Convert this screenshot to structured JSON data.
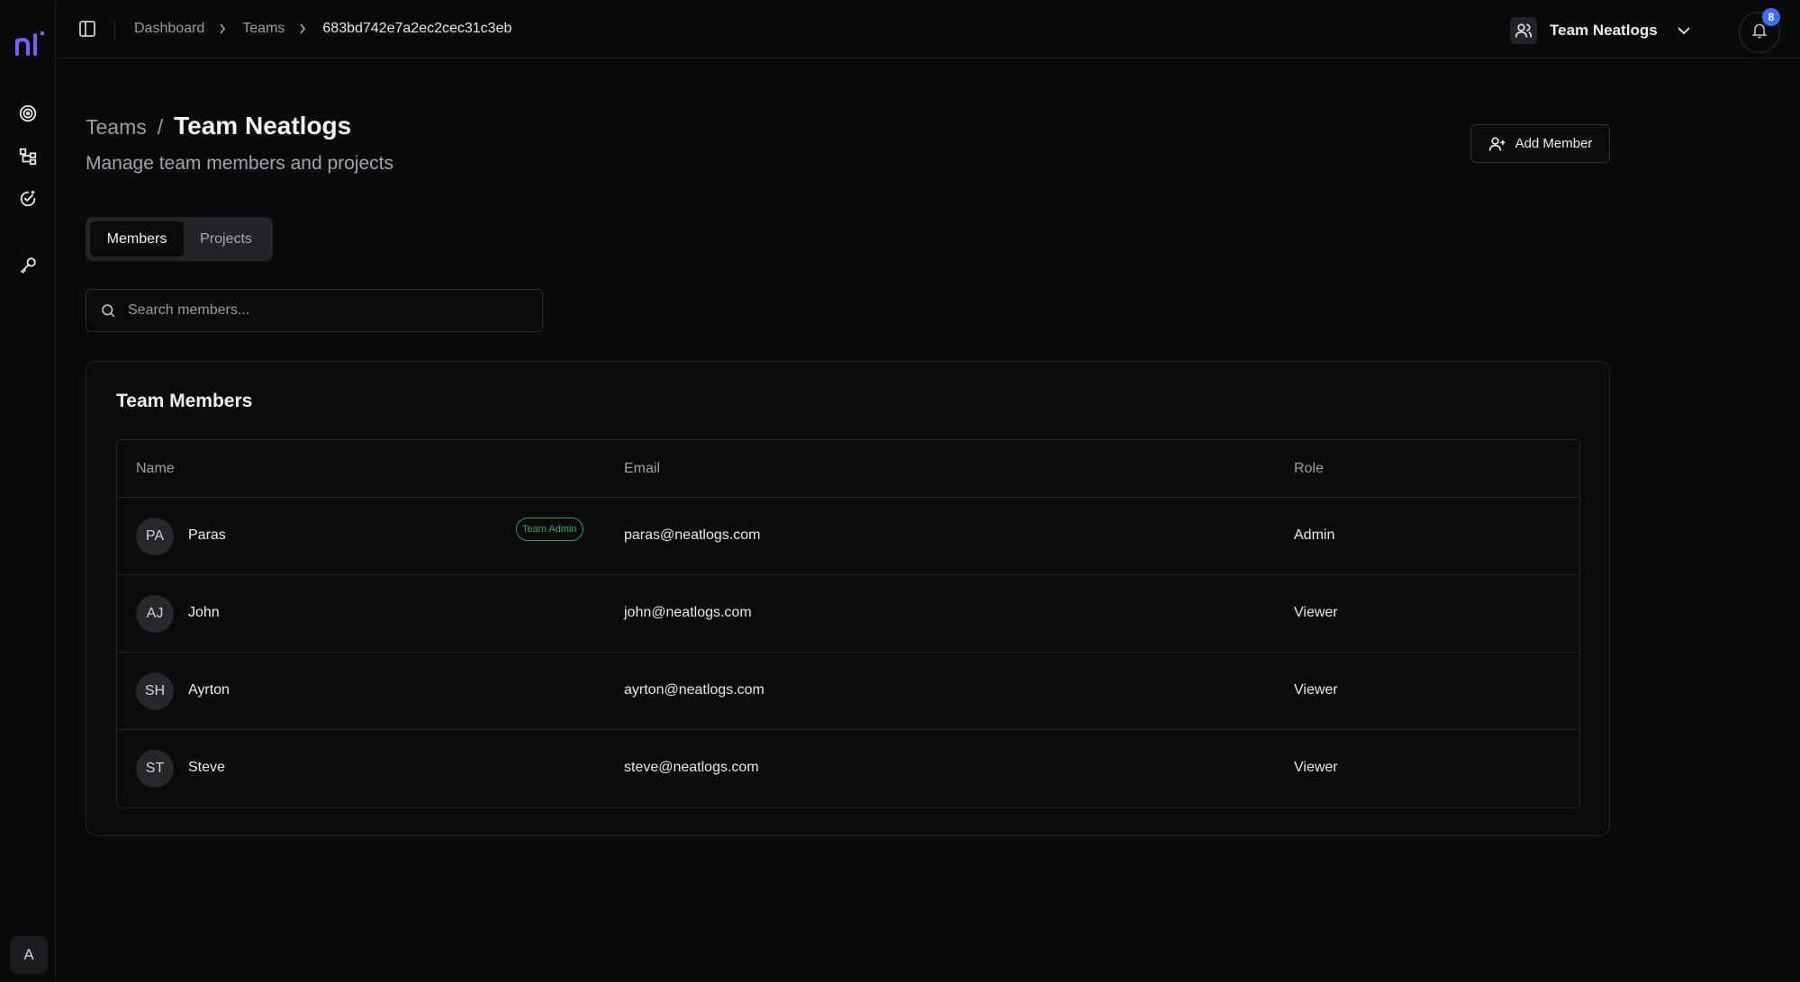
{
  "brand": {
    "logo_text": "nl",
    "accent": "#7c5cff"
  },
  "sidebar": {
    "nav": [
      {
        "icon": "target-icon"
      },
      {
        "icon": "workflow-icon"
      },
      {
        "icon": "badge-check-icon"
      },
      {
        "icon": "key-icon"
      }
    ],
    "user_initial": "A"
  },
  "topbar": {
    "breadcrumb": [
      "Dashboard",
      "Teams",
      "683bd742e7a2ec2cec31c3eb"
    ],
    "team_name": "Team Neatlogs",
    "notification_count": "8"
  },
  "header": {
    "crumb": "Teams",
    "separator": "/",
    "title": "Team Neatlogs",
    "subtitle": "Manage team members and projects",
    "add_member_label": "Add Member"
  },
  "tabs": [
    {
      "label": "Members",
      "active": true
    },
    {
      "label": "Projects",
      "active": false
    }
  ],
  "search": {
    "placeholder": "Search members...",
    "value": ""
  },
  "members_card": {
    "title": "Team Members",
    "columns": [
      "Name",
      "Email",
      "Role"
    ],
    "rows": [
      {
        "initials": "PA",
        "name": "Paras",
        "tag": "Team Admin",
        "email": "paras@neatlogs.com",
        "role": "Admin"
      },
      {
        "initials": "AJ",
        "name": "John",
        "tag": "",
        "email": "john@neatlogs.com",
        "role": "Viewer"
      },
      {
        "initials": "SH",
        "name": "Ayrton",
        "tag": "",
        "email": "ayrton@neatlogs.com",
        "role": "Viewer"
      },
      {
        "initials": "ST",
        "name": "Steve",
        "tag": "",
        "email": "steve@neatlogs.com",
        "role": "Viewer"
      }
    ]
  }
}
